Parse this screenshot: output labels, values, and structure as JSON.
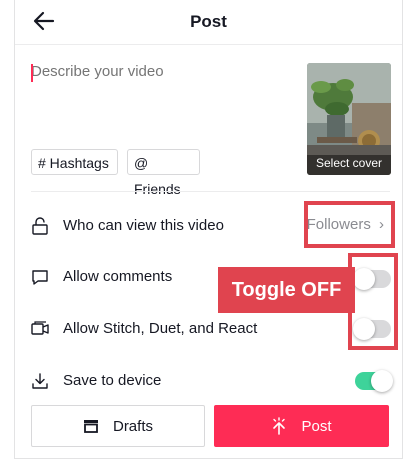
{
  "header": {
    "title": "Post"
  },
  "description": {
    "placeholder": "Describe your video"
  },
  "cover": {
    "label": "Select cover"
  },
  "chips": {
    "hashtags": "# Hashtags",
    "friends": "@ Friends"
  },
  "settings": {
    "who_can_view": {
      "label": "Who can view this video",
      "value": "Followers"
    },
    "allow_comments": {
      "label": "Allow comments",
      "enabled": false
    },
    "allow_stitch": {
      "label": "Allow Stitch, Duet, and React",
      "enabled": false
    },
    "save_to_device": {
      "label": "Save to device",
      "enabled": true
    }
  },
  "annotation": {
    "callout": "Toggle OFF",
    "highlight_color": "#e0444f"
  },
  "actions": {
    "drafts": "Drafts",
    "post": "Post"
  },
  "colors": {
    "accent": "#fe2c55",
    "toggle_on": "#3ed39a",
    "toggle_off": "#d9d9db"
  }
}
